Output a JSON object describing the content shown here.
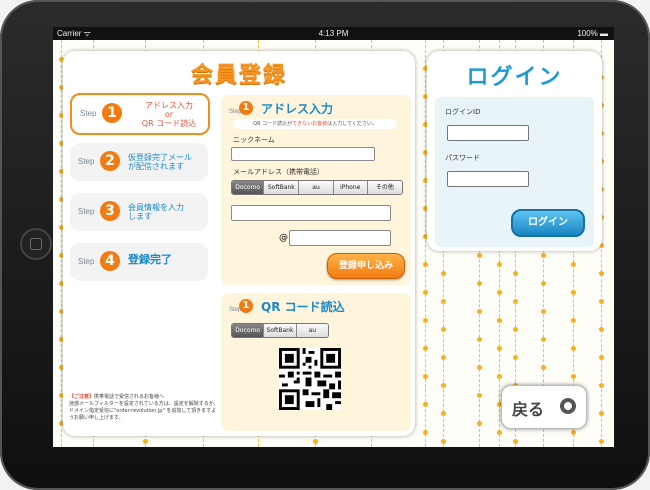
{
  "status_bar": {
    "carrier": "Carrier ᯤ",
    "time": "4:13 PM",
    "battery": "100% ▬"
  },
  "main": {
    "title": "会員登録"
  },
  "steps": [
    {
      "word": "Step",
      "num": "1",
      "label": "アドレス入力\nor\nQR コード読込"
    },
    {
      "word": "Step",
      "num": "2",
      "label": "仮登録完了メール\nが配信されます"
    },
    {
      "word": "Step",
      "num": "3",
      "label": "会員情報を入力\nします"
    },
    {
      "word": "Step",
      "num": "4",
      "label": "登録完了"
    }
  ],
  "form": {
    "step_word": "Step",
    "num": "1",
    "title": "アドレス入力",
    "note_prefix": "QR コード読込が",
    "note_warn": "できないお客様",
    "note_suffix": "は入力してください。",
    "nickname_label": "ニックネーム",
    "mail_label": "メールアドレス（携帯電話）",
    "carriers": [
      "Docomo",
      "SoftBank",
      "au",
      "iPhone",
      "その他"
    ],
    "at": "@",
    "submit": "登録申し込み"
  },
  "qr": {
    "step_word": "Step",
    "num": "1",
    "title": "QR コード読込",
    "carriers": [
      "Docomo",
      "SoftBank",
      "au"
    ]
  },
  "caution": {
    "tag": "【ご注意】",
    "text": "携帯電話で受信されるお客様へ\n迷惑メールフィルターを設定されている方は、設定を解除するか、ドメイン指定受信に\"order-revolution.jp\" を追加して頂きますようお願い申し上げます。"
  },
  "login": {
    "title": "ログイン",
    "id_label": "ログインID",
    "password_label": "パスワード",
    "button": "ログイン"
  },
  "back": {
    "label": "戻る"
  },
  "colors": {
    "accent_orange": "#f27b11",
    "accent_blue": "#1a89c9"
  }
}
